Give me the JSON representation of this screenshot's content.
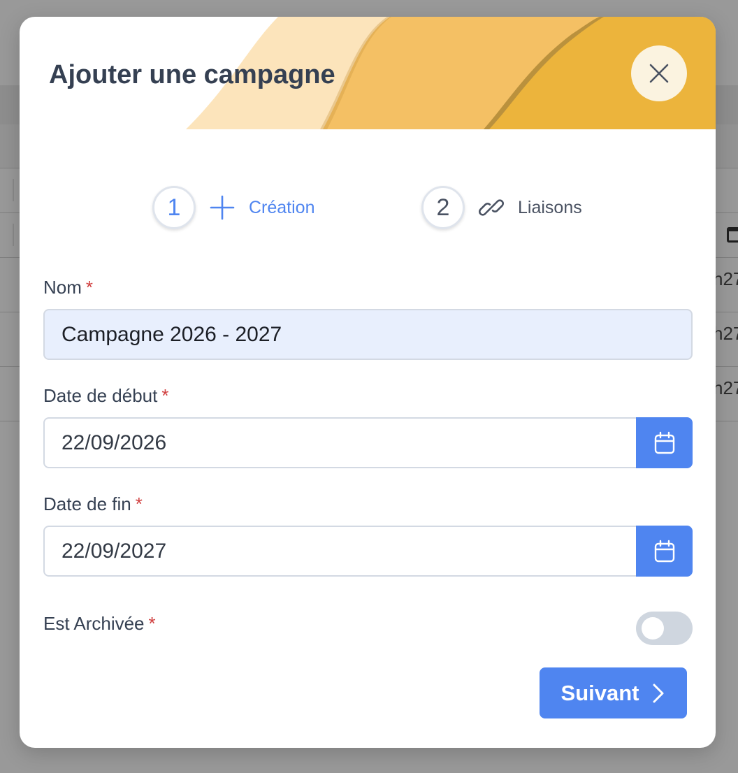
{
  "background": {
    "row_fragments": [
      "h27",
      "h27",
      "h27"
    ]
  },
  "modal": {
    "title": "Ajouter une campagne",
    "close_icon": "close-icon"
  },
  "steps": [
    {
      "number": "1",
      "icon": "plus-icon",
      "label": "Création",
      "active": true
    },
    {
      "number": "2",
      "icon": "link-icon",
      "label": "Liaisons",
      "active": false
    }
  ],
  "form": {
    "name": {
      "label": "Nom",
      "required_mark": "*",
      "value": "Campagne 2026 - 2027"
    },
    "start_date": {
      "label": "Date de début",
      "required_mark": "*",
      "value": "22/09/2026",
      "icon": "calendar-icon"
    },
    "end_date": {
      "label": "Date de fin",
      "required_mark": "*",
      "value": "22/09/2027",
      "icon": "calendar-icon"
    },
    "archived": {
      "label": "Est Archivée",
      "required_mark": "*",
      "on": false
    }
  },
  "footer": {
    "next_label": "Suivant",
    "next_icon": "chevron-right-icon"
  },
  "colors": {
    "primary": "#4f85f0",
    "title": "#354052",
    "required": "#d03f3f",
    "header_light": "#fce4bb",
    "header_mid": "#f4c064",
    "header_dark": "#ecb43c"
  }
}
